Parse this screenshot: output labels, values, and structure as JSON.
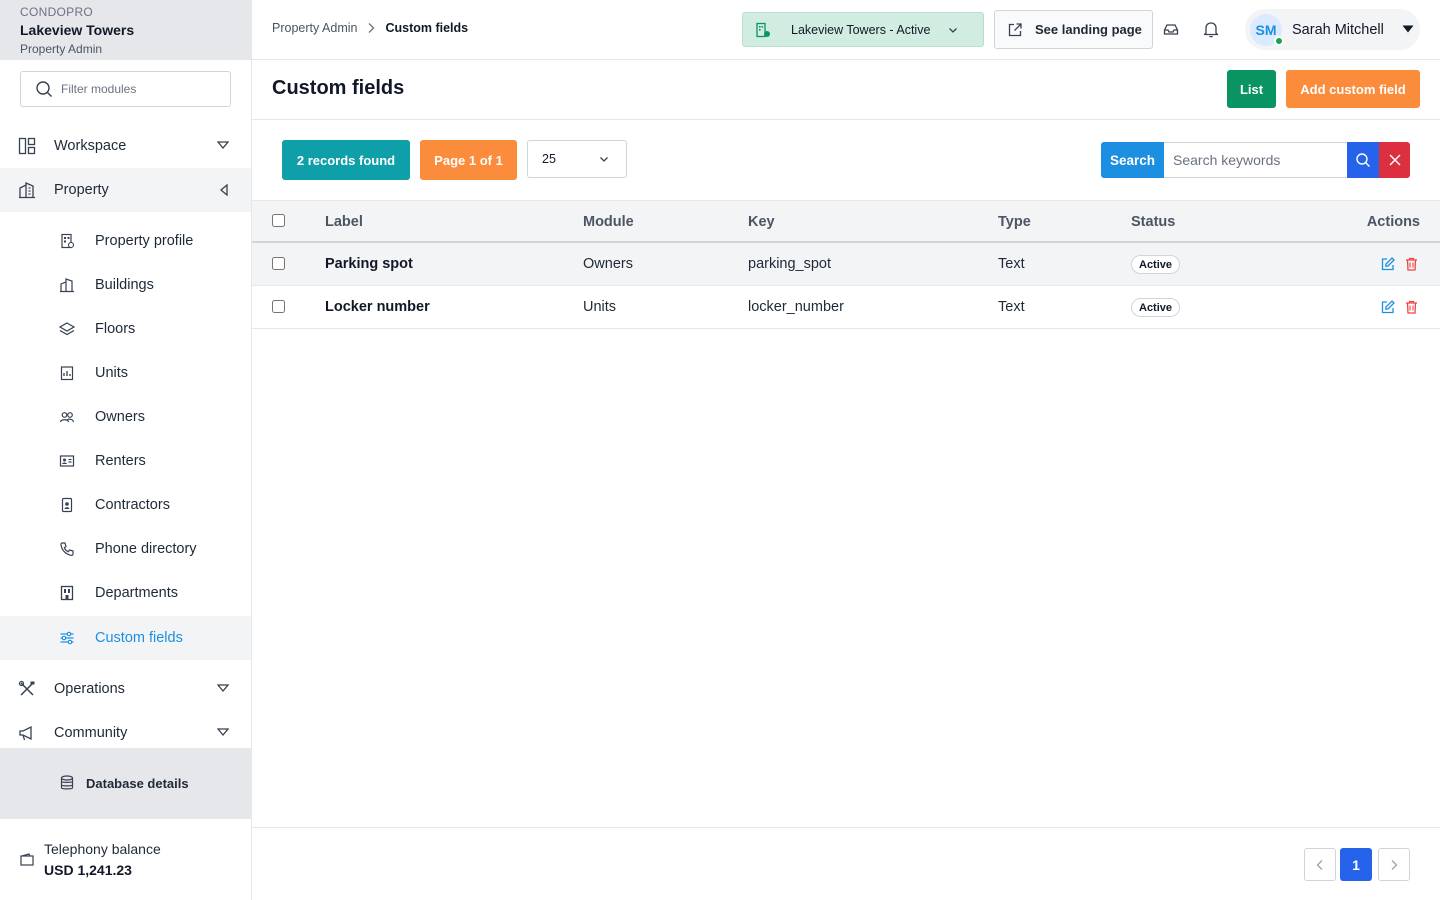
{
  "brand": {
    "top": "CONDOPRO",
    "name": "Lakeview Towers",
    "role": "Property Admin"
  },
  "sidebar": {
    "filter_placeholder": "Filter modules",
    "sections": [
      {
        "label": "Workspace",
        "icon": "workspace-icon",
        "state": "collapsed"
      },
      {
        "label": "Property",
        "icon": "building-icon",
        "state": "expanded"
      },
      {
        "label": "Operations",
        "icon": "tools-icon",
        "state": "collapsed"
      },
      {
        "label": "Community",
        "icon": "megaphone-icon",
        "state": "collapsed"
      }
    ],
    "property_items": [
      {
        "label": "Property profile",
        "icon": "property-profile-icon"
      },
      {
        "label": "Buildings",
        "icon": "buildings-icon"
      },
      {
        "label": "Floors",
        "icon": "layers-icon"
      },
      {
        "label": "Units",
        "icon": "units-icon"
      },
      {
        "label": "Owners",
        "icon": "users-icon"
      },
      {
        "label": "Renters",
        "icon": "id-card-icon"
      },
      {
        "label": "Contractors",
        "icon": "badge-icon"
      },
      {
        "label": "Phone directory",
        "icon": "phone-icon"
      },
      {
        "label": "Departments",
        "icon": "departments-icon"
      },
      {
        "label": "Custom fields",
        "icon": "sliders-icon",
        "active": true
      }
    ],
    "database_label": "Database details",
    "telephony": {
      "label": "Telephony balance",
      "value": "USD 1,241.23"
    }
  },
  "header": {
    "breadcrumb": [
      "Property Admin",
      "Custom fields"
    ],
    "property_select": "Lakeview Towers - Active",
    "landing_button": "See landing page",
    "user": {
      "initials": "SM",
      "name": "Sarah Mitchell"
    }
  },
  "page": {
    "title": "Custom fields",
    "list_button": "List",
    "add_button": "Add custom field"
  },
  "toolbar": {
    "records": "2 records found",
    "page": "Page 1 of 1",
    "per_page": "25",
    "search_label": "Search",
    "search_placeholder": "Search keywords"
  },
  "table": {
    "columns": [
      "Label",
      "Module",
      "Key",
      "Type",
      "Status",
      "Actions"
    ],
    "rows": [
      {
        "label": "Parking spot",
        "module": "Owners",
        "key": "parking_spot",
        "type": "Text",
        "status": "Active"
      },
      {
        "label": "Locker number",
        "module": "Units",
        "key": "locker_number",
        "type": "Text",
        "status": "Active"
      }
    ]
  },
  "pagination": {
    "current": "1"
  },
  "colors": {
    "accent_blue": "#1d8fe1",
    "green": "#0a9462",
    "orange": "#fa8c3c",
    "teal": "#0e9fa8",
    "red": "#dc2f40"
  }
}
